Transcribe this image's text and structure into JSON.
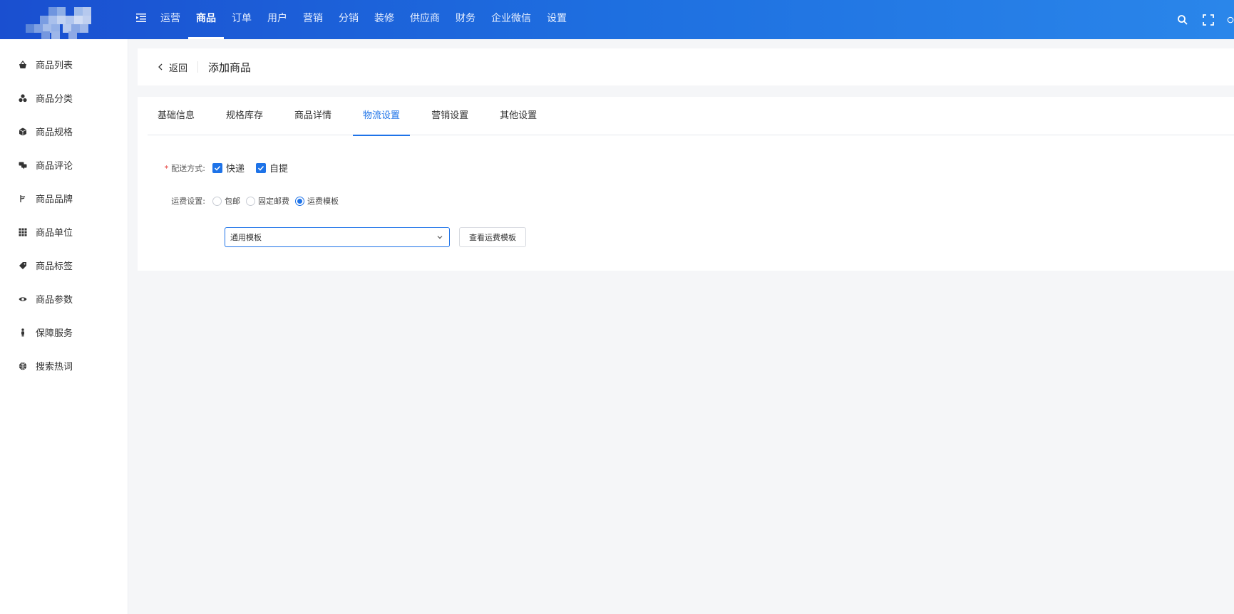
{
  "header": {
    "nav": [
      {
        "label": "运营",
        "active": false
      },
      {
        "label": "商品",
        "active": true
      },
      {
        "label": "订单",
        "active": false
      },
      {
        "label": "用户",
        "active": false
      },
      {
        "label": "营销",
        "active": false
      },
      {
        "label": "分销",
        "active": false
      },
      {
        "label": "装修",
        "active": false
      },
      {
        "label": "供应商",
        "active": false
      },
      {
        "label": "财务",
        "active": false
      },
      {
        "label": "企业微信",
        "active": false
      },
      {
        "label": "设置",
        "active": false
      }
    ],
    "icons": [
      "menu-collapse-icon",
      "search-icon",
      "fullscreen-icon"
    ]
  },
  "sidebar": {
    "items": [
      {
        "label": "商品列表",
        "icon": "basket-icon"
      },
      {
        "label": "商品分类",
        "icon": "category-icon"
      },
      {
        "label": "商品规格",
        "icon": "cube-icon"
      },
      {
        "label": "商品评论",
        "icon": "comment-icon"
      },
      {
        "label": "商品品牌",
        "icon": "brand-icon"
      },
      {
        "label": "商品单位",
        "icon": "grid-icon"
      },
      {
        "label": "商品标签",
        "icon": "tag-icon"
      },
      {
        "label": "商品参数",
        "icon": "eye-icon"
      },
      {
        "label": "保障服务",
        "icon": "person-icon"
      },
      {
        "label": "搜索热词",
        "icon": "globe-icon"
      }
    ]
  },
  "breadcrumb": {
    "back_label": "返回",
    "title": "添加商品"
  },
  "tabs": [
    {
      "label": "基础信息",
      "active": false
    },
    {
      "label": "规格库存",
      "active": false
    },
    {
      "label": "商品详情",
      "active": false
    },
    {
      "label": "物流设置",
      "active": true
    },
    {
      "label": "营销设置",
      "active": false
    },
    {
      "label": "其他设置",
      "active": false
    }
  ],
  "form": {
    "delivery": {
      "required_mark": "*",
      "label": "配送方式:",
      "options": [
        {
          "label": "快递",
          "checked": true
        },
        {
          "label": "自提",
          "checked": true
        }
      ]
    },
    "shipping": {
      "label": "运费设置:",
      "options": [
        {
          "label": "包邮",
          "selected": false
        },
        {
          "label": "固定邮费",
          "selected": false
        },
        {
          "label": "运费模板",
          "selected": true
        }
      ]
    },
    "template_select": {
      "value": "通用模板"
    },
    "view_template_button": "查看运费模板"
  },
  "colors": {
    "primary": "#1e73e8",
    "header_start": "#1a4fd0",
    "header_end": "#2a86ea"
  }
}
